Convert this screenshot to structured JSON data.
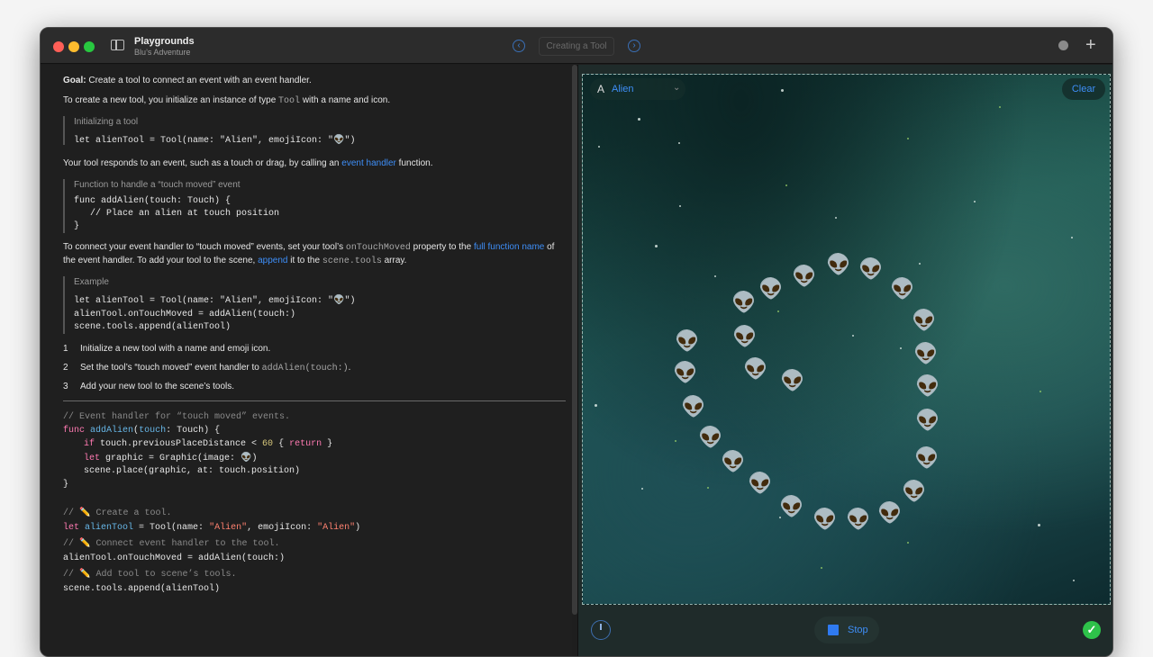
{
  "window": {
    "app_title": "Playgrounds",
    "app_subtitle": "Blu’s Adventure",
    "breadcrumb": "Creating a Tool",
    "nav_back": "‹",
    "nav_forward": "›",
    "new_tab": "+"
  },
  "guide": {
    "goal_label": "Goal:",
    "goal_text": " Create a tool to connect an event with an event handler.",
    "intro": {
      "a": "To create a new tool, you initialize an instance of type ",
      "code": "Tool",
      "b": " with a name and icon."
    },
    "block1": {
      "caption": "Initializing a tool",
      "lines": [
        "let alienTool = Tool(name: \"Alien\", emojiIcon: \"👽\")"
      ]
    },
    "event_text": {
      "a": "Your tool responds to an event, such as a touch or drag, by calling an ",
      "link": "event handler",
      "b": " function."
    },
    "block2": {
      "caption": "Function to handle a “touch moved” event",
      "lines": [
        "func addAlien(touch: Touch) {",
        "   // Place an alien at touch position",
        "}"
      ]
    },
    "connect_text": {
      "a": "To connect your event handler to “touch moved” events, set your tool’s ",
      "code1": "onTouchMoved",
      "b": " property to the ",
      "link1": "full function name",
      "c": " of",
      "d": "the event handler. To add your tool to the scene, ",
      "link2": "append",
      "e": " it to the ",
      "code2": "scene.tools",
      "f": " array."
    },
    "block3": {
      "caption": "Example",
      "lines": [
        "let alienTool = Tool(name: \"Alien\", emojiIcon: \"👽\")",
        "alienTool.onTouchMoved = addAlien(touch:)",
        "scene.tools.append(alienTool)"
      ]
    },
    "steps": [
      {
        "num": "1",
        "text": "Initialize a new tool with a name and emoji icon."
      },
      {
        "num": "2",
        "text": "Set the tool’s “touch moved” event handler to ",
        "code": "addAlien(touch:)",
        "tail": "."
      },
      {
        "num": "3",
        "text": "Add your new tool to the scene’s tools."
      }
    ]
  },
  "code": {
    "l1": "// Event handler for “touch moved” events.",
    "l2": {
      "kw": "func",
      "fn": "addAlien",
      "p1": "(",
      "param": "touch",
      "p2": ": Touch) {"
    },
    "l3": {
      "kw": "if",
      "a": " touch.previousPlaceDistance < ",
      "num": "60",
      "b": " { ",
      "kw2": "return",
      "c": " }"
    },
    "l4": {
      "kw": "let",
      "a": " graphic = Graphic(image: ",
      "emoji": "👽",
      "b": ")"
    },
    "l5": "scene.place(graphic, at: touch.position)",
    "l6": "}",
    "l7": "// ✏️ Create a tool.",
    "l8": {
      "kw": "let",
      "var": "alienTool",
      "a": " = Tool(name: ",
      "s1": "\"Alien\"",
      "b": ", emojiIcon: ",
      "s2": "\"Alien\"",
      "c": ")"
    },
    "l9": "// ✏️ Connect event handler to the tool.",
    "l10": "alienTool.onTouchMoved = addAlien(touch:)",
    "l11": "// ✏️ Add tool to scene’s tools.",
    "l12": "scene.tools.append(alienTool)"
  },
  "live_view": {
    "tool_icon": "A",
    "tool_name": "Alien",
    "clear_label": "Clear",
    "stop_label": "Stop",
    "alien_emoji": "👽",
    "alien_count": 31,
    "status": "success"
  },
  "colors": {
    "accent": "#3e8ef7",
    "keyword": "#ff7ab2",
    "string": "#ff8170",
    "comment": "#8a8a8a",
    "success": "#2ec24a"
  }
}
